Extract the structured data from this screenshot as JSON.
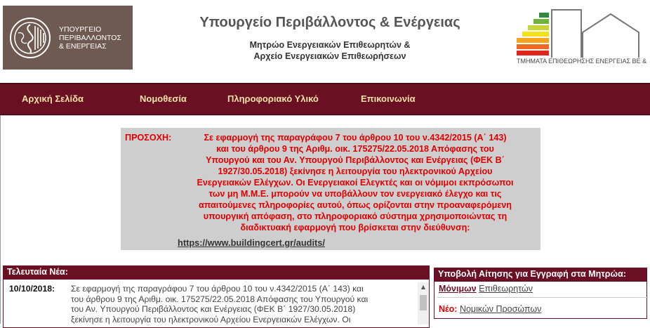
{
  "header": {
    "logo_text": [
      "ΥΠΟΥΡΓΕΙΟ",
      "ΠΕΡΙΒΑΛΛΟΝΤΟΣ",
      "& ΕΝΕΡΓΕΙΑΣ"
    ],
    "title": "Υπουργείο Περιβάλλοντος & Ενέργειας",
    "subtitle_line1": "Μητρώο Ενεργειακών Επιθεωρητών &",
    "subtitle_line2": "Αρχείο Ενεργειακών Επιθεωρήσεων",
    "energy_caption": "ΤΜΗΜΑΤΑ ΕΠΙΘΕΩΡΗΣΗΣ ΕΝΕΡΓΕΙΑΣ ΒΕ &",
    "energy_bar_colors": [
      "#2e8b3a",
      "#6fb43f",
      "#c8d534",
      "#f4e11c",
      "#f6a31d",
      "#ee6a22",
      "#e0241c"
    ]
  },
  "nav": {
    "items": [
      "Αρχική Σελίδα",
      "Νομοθεσία",
      "Πληροφοριακό Υλικό",
      "Επικοινωνία"
    ]
  },
  "notice": {
    "label": "ΠΡΟΣΟΧΗ:",
    "lines": [
      "Σε εφαρμογή της παραγράφου 7 του άρθρου 10 του ν.4342/2015 (Α΄ 143)",
      "και του άρθρου 9 της Αριθμ. οικ. 175275/22.05.2018 Απόφασης του",
      "Υπουργού και του Αν. Υπουργού Περιβάλλοντος και Ενέργειας (ΦΕΚ Β΄",
      "1927/30.05.2018) ξεκίνησε η λειτουργία του ηλεκτρονικού Αρχείου",
      "Ενεργειακών Ελέγχων. Οι Ενεργειακοί Ελεγκτές και οι νόμιμοι εκπρόσωποι",
      "των μη Μ.Μ.Ε. μπορούν να υποβάλλουν τον ενεργειακό έλεγχο και τις",
      "απαιτούμενες πληροφορίες αυτού, όπως ορίζονται στην προαναφερόμενη",
      "υπουργική απόφαση, στο πληροφοριακό σύστημα χρησιμοποιώντας τη",
      "διαδικτυακή εφαρμογή που βρίσκεται στην διεύθυνση:"
    ],
    "link": "https://www.buildingcert.gr/audits/"
  },
  "news": {
    "title": "Τελευταία Νέα:",
    "date": "10/10/2018:",
    "lines": [
      "Σε εφαρμογή της παραγράφου 7 του άρθρου 10 του ν.4342/2015 (Α΄ 143) και",
      "του άρθρου 9 της Αριθμ. οικ. 175275/22.05.2018 Απόφασης του Υπουργού και",
      "του Αν. Υπουργού Περιβάλλοντος και Ενέργειας (ΦΕΚ Β΄ 1927/30.05.2018)",
      "ξεκίνησε η λειτουργία του ηλεκτρονικού Αρχείου Ενεργειακών Ελέγχων. Οι"
    ]
  },
  "registration": {
    "title": "Υποβολή Αίτησης για Εγγραφή στα Μητρώα:",
    "line1_strong": "Μόνιμων",
    "line1_link": "Επιθεωρητών",
    "line2_new": "Νέο:",
    "line2_link": "Νομικών Προσώπων"
  }
}
